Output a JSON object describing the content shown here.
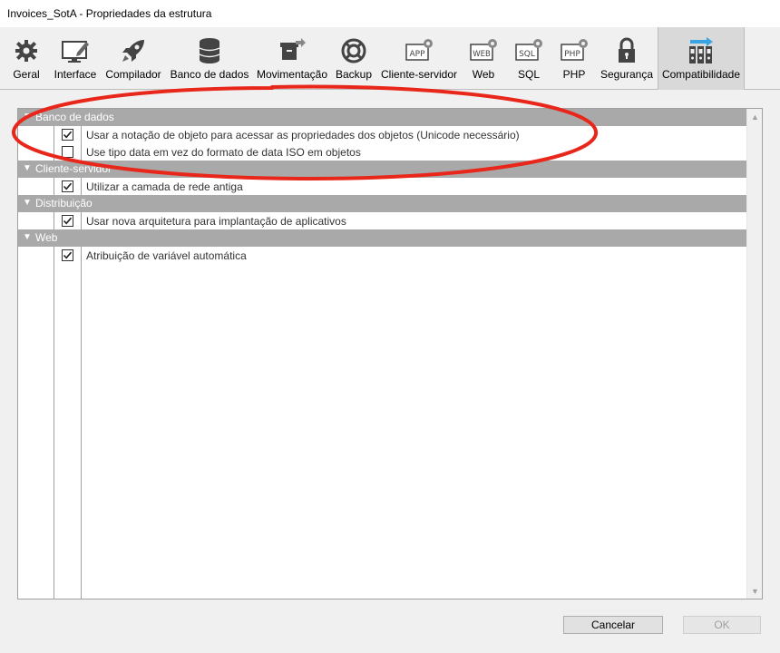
{
  "window": {
    "title": "Invoices_SotA - Propriedades da estrutura"
  },
  "toolbar": {
    "items": [
      {
        "label": "Geral",
        "icon": "gear-icon"
      },
      {
        "label": "Interface",
        "icon": "monitor-pencil-icon"
      },
      {
        "label": "Compilador",
        "icon": "rocket-icon"
      },
      {
        "label": "Banco de dados",
        "icon": "database-icon"
      },
      {
        "label": "Movimentação",
        "icon": "box-arrow-icon"
      },
      {
        "label": "Backup",
        "icon": "lifebuoy-icon"
      },
      {
        "label": "Cliente-servidor",
        "icon": "app-gear-icon",
        "badge": "APP"
      },
      {
        "label": "Web",
        "icon": "web-gear-icon",
        "badge": "WEB"
      },
      {
        "label": "SQL",
        "icon": "sql-gear-icon",
        "badge": "SQL"
      },
      {
        "label": "PHP",
        "icon": "php-gear-icon",
        "badge": "PHP"
      },
      {
        "label": "Segurança",
        "icon": "padlock-icon"
      },
      {
        "label": "Compatibilidade",
        "icon": "binders-arrow-icon",
        "selected": true
      }
    ]
  },
  "sections": [
    {
      "title": "Banco de dados",
      "options": [
        {
          "label": "Usar a notação de objeto para acessar as propriedades dos objetos (Unicode necessário)",
          "checked": true
        },
        {
          "label": "Use tipo data em vez do formato de data ISO em objetos",
          "checked": false
        }
      ]
    },
    {
      "title": "Cliente-servidor",
      "options": [
        {
          "label": "Utilizar a camada de rede antiga",
          "checked": true
        }
      ]
    },
    {
      "title": "Distribuição",
      "options": [
        {
          "label": "Usar nova arquitetura para implantação de aplicativos",
          "checked": true
        }
      ]
    },
    {
      "title": "Web",
      "options": [
        {
          "label": "Atribuição de variável automática",
          "checked": true
        }
      ]
    }
  ],
  "buttons": {
    "cancel": "Cancelar",
    "ok": "OK"
  },
  "colors": {
    "section_header_bg": "#a9a9a9",
    "selected_tab_bg": "#d9d9d9",
    "annotation_ellipse": "#e8261a"
  }
}
